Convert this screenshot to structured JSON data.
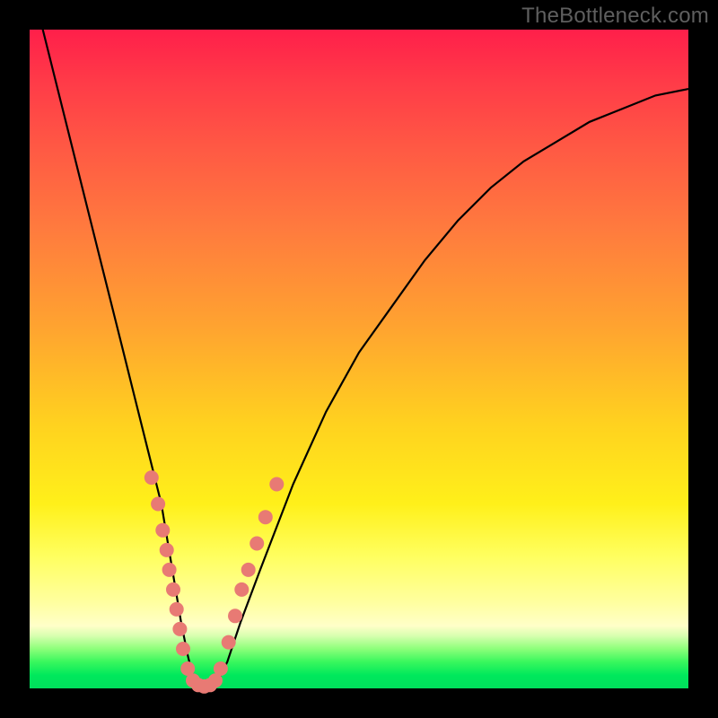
{
  "watermark": "TheBottleneck.com",
  "colors": {
    "frame": "#000000",
    "gradient_top": "#ff1f4a",
    "gradient_mid": "#ffd21f",
    "gradient_bottom": "#00df5c",
    "curve": "#000000",
    "dots": "#e87a74"
  },
  "chart_data": {
    "type": "line",
    "title": "",
    "xlabel": "",
    "ylabel": "",
    "xlim": [
      0,
      100
    ],
    "ylim": [
      0,
      100
    ],
    "series": [
      {
        "name": "bottleneck-curve",
        "x": [
          2,
          5,
          8,
          11,
          14,
          16,
          18,
          20,
          21,
          22,
          23,
          24,
          25,
          26,
          28,
          30,
          32,
          35,
          40,
          45,
          50,
          55,
          60,
          65,
          70,
          75,
          80,
          85,
          90,
          95,
          100
        ],
        "y": [
          100,
          88,
          76,
          64,
          52,
          44,
          36,
          28,
          22,
          16,
          10,
          5,
          1,
          0,
          0,
          4,
          10,
          18,
          31,
          42,
          51,
          58,
          65,
          71,
          76,
          80,
          83,
          86,
          88,
          90,
          91
        ]
      }
    ],
    "markers": [
      {
        "x": 18.5,
        "y": 32
      },
      {
        "x": 19.5,
        "y": 28
      },
      {
        "x": 20.2,
        "y": 24
      },
      {
        "x": 20.8,
        "y": 21
      },
      {
        "x": 21.2,
        "y": 18
      },
      {
        "x": 21.8,
        "y": 15
      },
      {
        "x": 22.3,
        "y": 12
      },
      {
        "x": 22.8,
        "y": 9
      },
      {
        "x": 23.3,
        "y": 6
      },
      {
        "x": 24.0,
        "y": 3
      },
      {
        "x": 24.8,
        "y": 1.2
      },
      {
        "x": 25.6,
        "y": 0.5
      },
      {
        "x": 26.5,
        "y": 0.3
      },
      {
        "x": 27.4,
        "y": 0.5
      },
      {
        "x": 28.2,
        "y": 1.2
      },
      {
        "x": 29.0,
        "y": 3
      },
      {
        "x": 30.2,
        "y": 7
      },
      {
        "x": 31.2,
        "y": 11
      },
      {
        "x": 32.2,
        "y": 15
      },
      {
        "x": 33.2,
        "y": 18
      },
      {
        "x": 34.5,
        "y": 22
      },
      {
        "x": 35.8,
        "y": 26
      },
      {
        "x": 37.5,
        "y": 31
      }
    ]
  }
}
